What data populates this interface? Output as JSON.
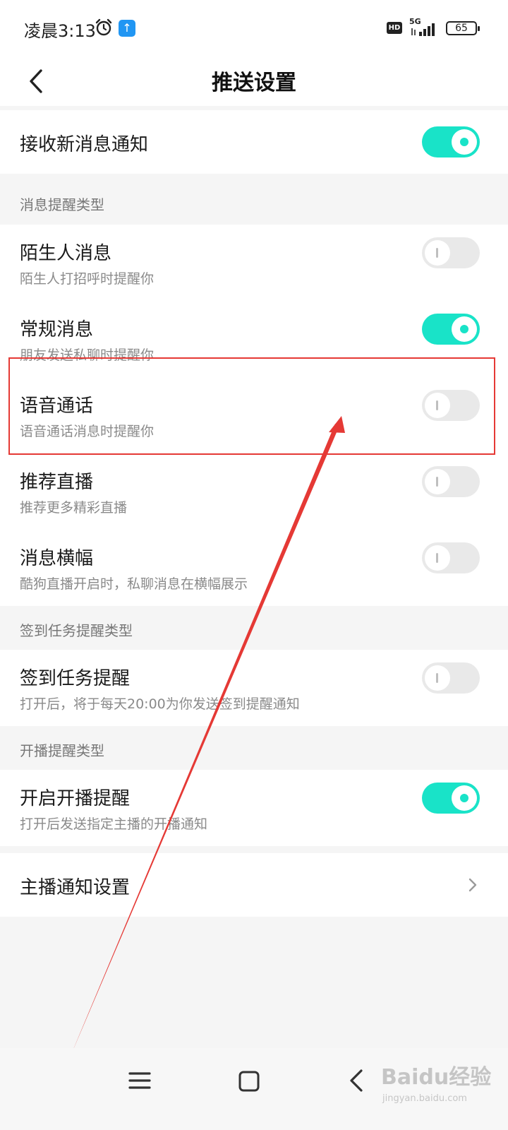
{
  "status_bar": {
    "time": "凌晨3:13",
    "hd_badge": "HD",
    "network": "5G",
    "battery": "65"
  },
  "header": {
    "title": "推送设置"
  },
  "main_toggle": {
    "label": "接收新消息通知",
    "on": true
  },
  "sections": [
    {
      "header": "消息提醒类型",
      "items": [
        {
          "title": "陌生人消息",
          "subtitle": "陌生人打招呼时提醒你",
          "on": false
        },
        {
          "title": "常规消息",
          "subtitle": "朋友发送私聊时提醒你",
          "on": true
        },
        {
          "title": "语音通话",
          "subtitle": "语音通话消息时提醒你",
          "on": false
        },
        {
          "title": "推荐直播",
          "subtitle": "推荐更多精彩直播",
          "on": false
        },
        {
          "title": "消息横幅",
          "subtitle": "酷狗直播开启时，私聊消息在横幅展示",
          "on": false
        }
      ]
    },
    {
      "header": "签到任务提醒类型",
      "items": [
        {
          "title": "签到任务提醒",
          "subtitle": "打开后，将于每天20:00为你发送签到提醒通知",
          "on": false
        }
      ]
    },
    {
      "header": "开播提醒类型",
      "items": [
        {
          "title": "开启开播提醒",
          "subtitle": "打开后发送指定主播的开播通知",
          "on": true
        }
      ]
    }
  ],
  "streamer_settings": {
    "label": "主播通知设置"
  },
  "colors": {
    "accent": "#19e3c8",
    "toggle_off": "#e9e9e9",
    "annotation": "#e53935"
  },
  "watermark": {
    "logo": "Baidu经验",
    "url": "jingyan.baidu.com"
  }
}
